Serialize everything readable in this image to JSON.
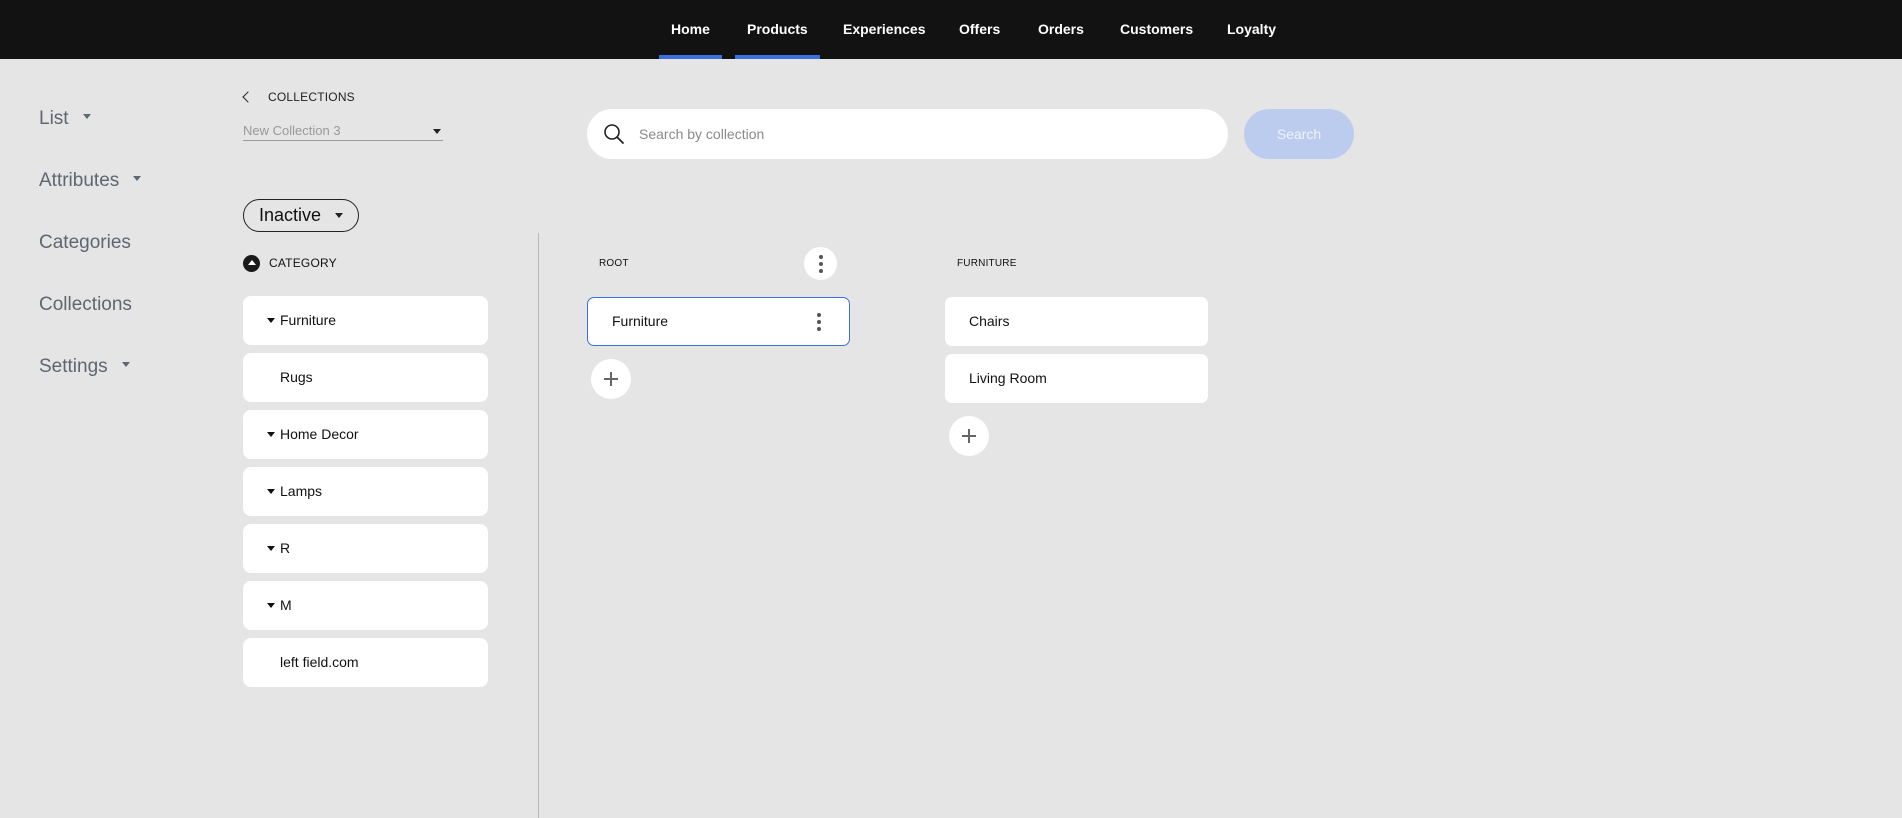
{
  "topnav": {
    "items": [
      {
        "label": "Home",
        "active": true
      },
      {
        "label": "Products",
        "active": true
      },
      {
        "label": "Experiences",
        "active": false
      },
      {
        "label": "Offers",
        "active": false
      },
      {
        "label": "Orders",
        "active": false
      },
      {
        "label": "Customers",
        "active": false
      },
      {
        "label": "Loyalty",
        "active": false
      }
    ],
    "accent_color": "#3b6fe0"
  },
  "sidebar": {
    "items": [
      {
        "label": "List",
        "has_caret": true
      },
      {
        "label": "Attributes",
        "has_caret": true
      },
      {
        "label": "Categories",
        "has_caret": false
      },
      {
        "label": "Collections",
        "has_caret": false
      },
      {
        "label": "Settings",
        "has_caret": true
      }
    ]
  },
  "header": {
    "back_label": "COLLECTIONS",
    "collection_select_value": "New Collection 3"
  },
  "search": {
    "placeholder": "Search by collection",
    "button_label": "Search"
  },
  "status_dropdown": {
    "value": "Inactive"
  },
  "category_panel": {
    "title": "CATEGORY",
    "items": [
      {
        "label": "Furniture",
        "expandable": true
      },
      {
        "label": "Rugs",
        "expandable": false
      },
      {
        "label": "Home Decor",
        "expandable": true
      },
      {
        "label": "Lamps",
        "expandable": true
      },
      {
        "label": "R",
        "expandable": true
      },
      {
        "label": "M",
        "expandable": true
      },
      {
        "label": "left field.com",
        "expandable": false
      }
    ]
  },
  "columns": [
    {
      "title": "ROOT",
      "items": [
        {
          "label": "Furniture",
          "selected": true
        }
      ]
    },
    {
      "title": "FURNITURE",
      "items": [
        {
          "label": "Chairs",
          "selected": false
        },
        {
          "label": "Living Room",
          "selected": false
        }
      ]
    }
  ]
}
